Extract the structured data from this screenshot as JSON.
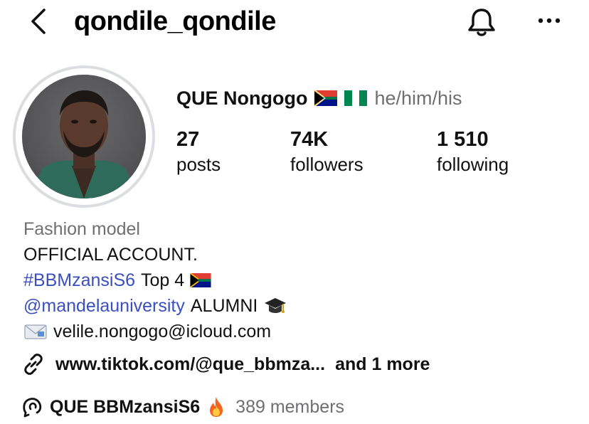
{
  "header": {
    "back_icon": "chevron-left-icon",
    "username": "qondile_qondile",
    "notifications_icon": "bell-icon",
    "more_icon": "more-horizontal-icon"
  },
  "profile": {
    "display_name": "QUE Nongogo",
    "name_flags": [
      "south-africa-flag-icon",
      "nigeria-flag-icon"
    ],
    "pronouns": "he/him/his"
  },
  "stats": [
    {
      "value": "27",
      "label": "posts"
    },
    {
      "value": "74K",
      "label": "followers"
    },
    {
      "value": "1 510",
      "label": "following"
    }
  ],
  "bio": {
    "category": "Fashion model",
    "line1": "OFFICIAL ACCOUNT.",
    "hashtag": "#BBMzansiS6",
    "hashtag_suffix": "Top 4",
    "mention": "@mandelauniversity",
    "mention_suffix": "ALUMNI",
    "email_icon": "envelope-icon",
    "email": "velile.nongogo@icloud.com"
  },
  "links": {
    "icon": "link-icon",
    "url": "www.tiktok.com/@que_bbmza...",
    "more": "and 1 more"
  },
  "channel": {
    "icon": "broadcast-channel-icon",
    "name": "QUE BBMzansiS6",
    "emoji_icon": "fire-icon",
    "members": "389 members"
  },
  "colors": {
    "link_blue": "#3a4fc0",
    "secondary_gray": "#6f6f73",
    "avatar_ring": "#dcdde1"
  }
}
